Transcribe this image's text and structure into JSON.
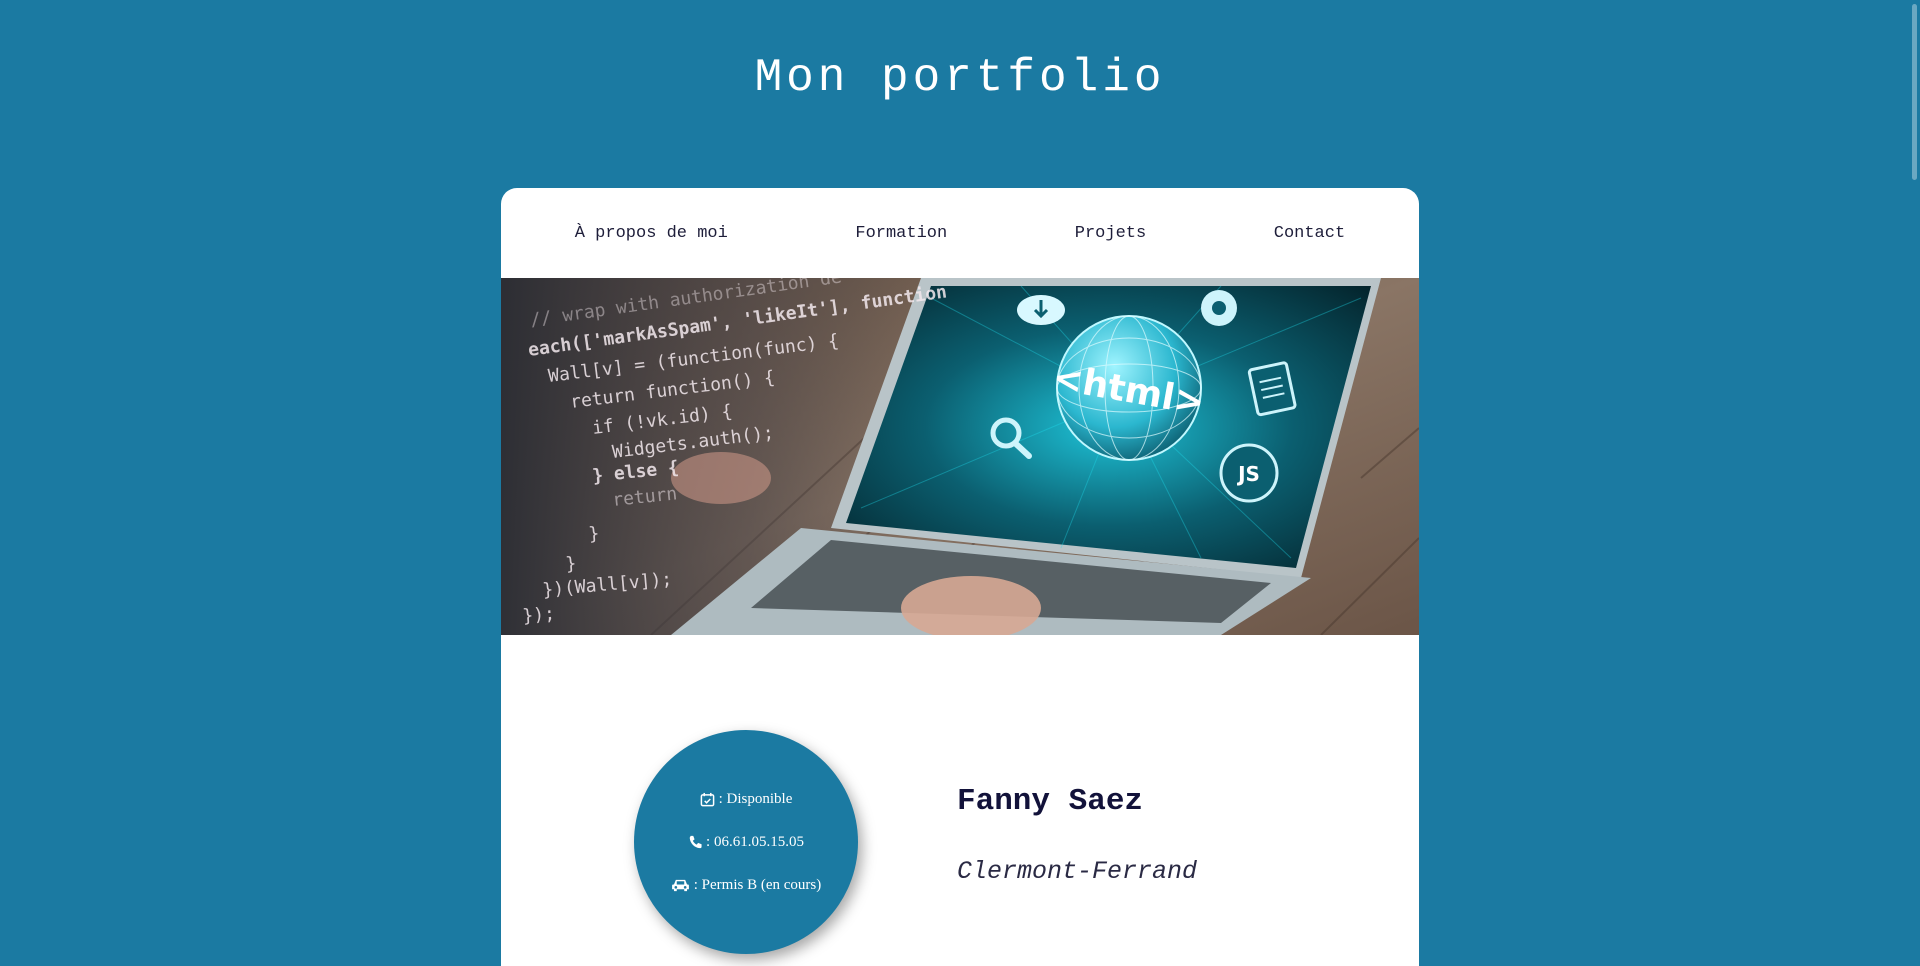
{
  "header": {
    "title": "Mon portfolio"
  },
  "nav": {
    "items": [
      {
        "label": "À propos de moi"
      },
      {
        "label": "Formation"
      },
      {
        "label": "Projets"
      },
      {
        "label": "Contact"
      }
    ]
  },
  "hero": {
    "code_lines": [
      "// wrap with authorization de",
      "each(['markAsSpam', 'likeIt'], function",
      "Wall[v] = (function(func) {",
      "return function() {",
      "if (!vk.id) {",
      "Widgets.auth();",
      "} else {",
      "return",
      "}",
      "}",
      "})(Wall[v]);",
      "});"
    ],
    "screen_text": "<html>",
    "badge_text": "JS"
  },
  "profile": {
    "availability": ": Disponible",
    "phone": ": 06.61.05.15.05",
    "license": ": Permis B (en cours)",
    "name": "Fanny Saez",
    "city": "Clermont-Ferrand"
  },
  "colors": {
    "background": "#1b7aa2",
    "card": "#ffffff",
    "circle": "#1b7aa2",
    "name_text": "#12123a"
  },
  "icons": [
    "calendar-check-icon",
    "phone-icon",
    "car-icon"
  ]
}
